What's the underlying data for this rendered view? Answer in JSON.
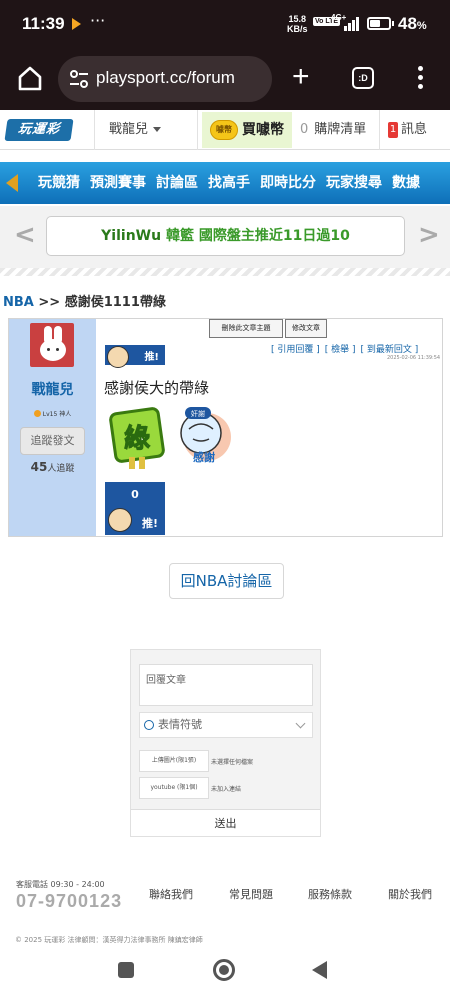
{
  "status_bar": {
    "time": "11:39",
    "dots": "···",
    "net_speed_value": "15.8",
    "net_speed_unit": "KB/s",
    "volte": "Vo LTE",
    "network": "4G+",
    "battery": "48",
    "battery_unit": "%"
  },
  "browser": {
    "url": "playsport.cc/forum",
    "tab_label": ":D"
  },
  "site_header": {
    "logo": "玩運彩",
    "username": "戰龍兒",
    "buy_coin": "買噱幣",
    "coin_icon_text": "噱幣",
    "cart_count": "0",
    "cart_label": "購牌清單",
    "msg_count": "1",
    "msg_label": "訊息"
  },
  "nav": {
    "items": [
      "玩競猜",
      "預測賽事",
      "討論區",
      "找高手",
      "即時比分",
      "玩家搜尋",
      "數據"
    ]
  },
  "announcement": {
    "user": "YilinWu",
    "text": "韓籃 國際盤主推近11日過10"
  },
  "breadcrumb": {
    "category": "NBA",
    "sep": ">>",
    "title": "感謝侯1111帶綠"
  },
  "post": {
    "author": "戰龍兒",
    "level": "Lv15 神人",
    "follow_button": "追蹤發文",
    "followers_count": "45",
    "followers_label": "人追蹤",
    "delete_button": "刪除此文章主題",
    "edit_button": "修改文章",
    "push_label": "推!",
    "links": [
      "[ 引用回覆 ]",
      "[ 檢舉 ]",
      "[ 到最新回文 ]"
    ],
    "timestamp": "2025-02-06 11:39:54",
    "content": "感謝侯大的帶綠",
    "sticker1_text": "綠",
    "sticker2_text": "感謝",
    "sticker2_badge": "奸謝",
    "push_count": "0",
    "push_box_label": "推!"
  },
  "back_button": "回NBA討論區",
  "reply_form": {
    "textarea_placeholder": "回覆文章",
    "emoji_label": "表情符號",
    "upload_button": "上傳圖片(限1張)",
    "upload_status": "未選擇任何檔案",
    "youtube_button": "youtube (限1個)",
    "youtube_status": "未加入連結",
    "send_button": "送出"
  },
  "footer": {
    "service_label": "客服電話 09:30 - 24:00",
    "phone": "07-9700123",
    "links": [
      "聯絡我們",
      "常見問題",
      "服務條款",
      "關於我們"
    ],
    "copyright": "© 2025 玩運彩 法律顧問：漢英得力法律事務所 陳鎮宏律師"
  },
  "colors": {
    "nav_blue": "#1a86cc",
    "link_blue": "#1565a8",
    "announcement_green": "#3a9a2a",
    "profile_bg": "#bfd6f3"
  }
}
